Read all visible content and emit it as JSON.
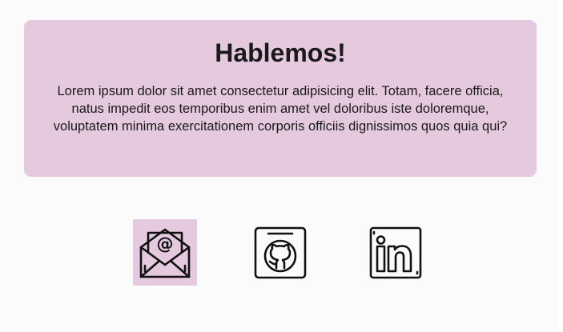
{
  "contact": {
    "title": "Hablemos!",
    "description": "Lorem ipsum dolor sit amet consectetur adipisicing elit. Totam, facere officia, natus impedit eos temporibus enim amet vel doloribus iste doloremque, voluptatem minima exercitationem corporis officiis dignissimos quos quia qui?",
    "background_color": "#e5c9de"
  },
  "social_links": [
    {
      "icon": "email-icon",
      "active": true
    },
    {
      "icon": "github-icon",
      "active": false
    },
    {
      "icon": "linkedin-icon",
      "active": false
    }
  ],
  "colors": {
    "page_background": "#fbfbfb",
    "accent": "#e5c9de",
    "text": "#1a1a1a"
  }
}
